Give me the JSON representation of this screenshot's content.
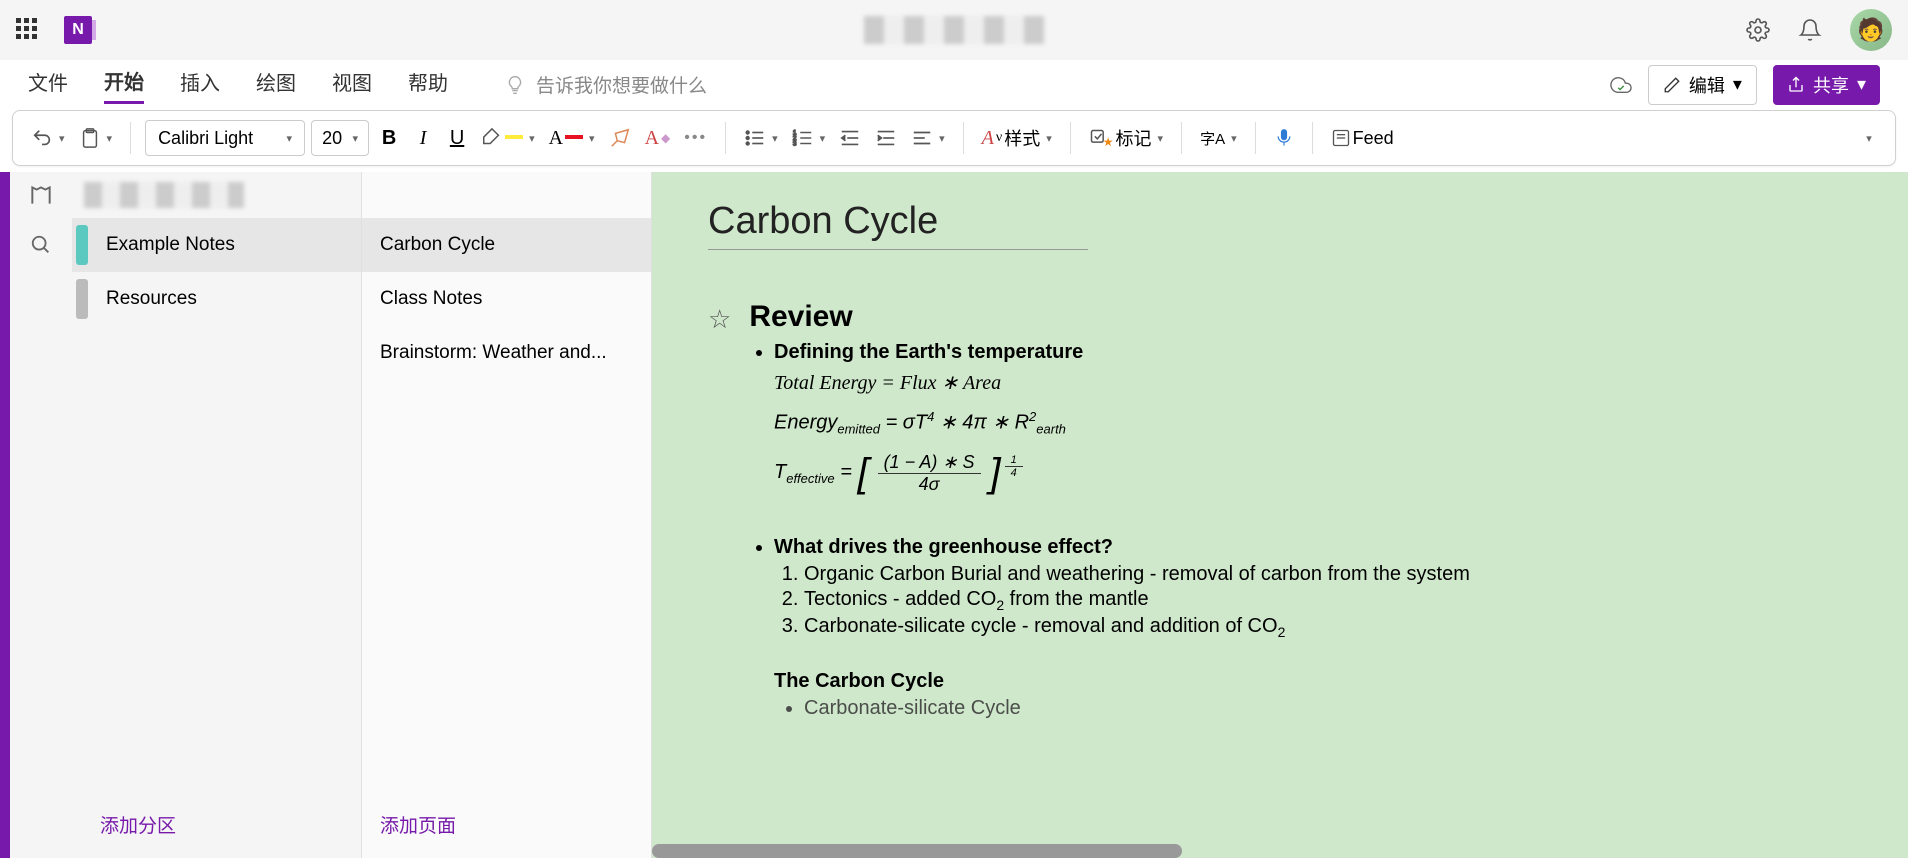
{
  "menu": {
    "file": "文件",
    "home": "开始",
    "insert": "插入",
    "draw": "绘图",
    "view": "视图",
    "help": "帮助",
    "tellme": "告诉我你想要做什么",
    "edit": "编辑",
    "share": "共享"
  },
  "ribbon": {
    "font": "Calibri Light",
    "size": "20",
    "styles": "样式",
    "tag": "标记",
    "editor": "字A",
    "feed": "Feed"
  },
  "sections": {
    "add": "添加分区",
    "items": [
      {
        "label": "Example Notes",
        "active": true
      },
      {
        "label": "Resources",
        "active": false
      }
    ]
  },
  "pages": {
    "add": "添加页面",
    "items": [
      {
        "label": "Carbon Cycle",
        "active": true
      },
      {
        "label": "Class Notes",
        "active": false
      },
      {
        "label": "Brainstorm: Weather and...",
        "active": false
      }
    ]
  },
  "note": {
    "title": "Carbon Cycle",
    "review": "Review",
    "def_line": "Defining the Earth's temperature",
    "formula1_a": "Total Energy = Flux ∗ Area",
    "formula2_a": "Energy",
    "formula2_sub": "emitted",
    "formula2_b": " = σT",
    "formula2_c": " ∗ 4π ∗ R",
    "formula2_sub2": "earth",
    "formula3_a": "T",
    "formula3_sub": "effective",
    "formula3_b": " = ",
    "formula3_num": "(1 − A) ∗ S",
    "formula3_den": "4σ",
    "greenhouse_q": "What drives the greenhouse effect?",
    "gh1": "Organic Carbon Burial and weathering - removal of carbon from the system",
    "gh2_a": "Tectonics - added CO",
    "gh2_b": " from the mantle",
    "gh3_a": "Carbonate-silicate cycle - removal and addition of CO",
    "carbon_h": "The Carbon Cycle",
    "carbon_b1": "Carbonate-silicate Cycle"
  }
}
